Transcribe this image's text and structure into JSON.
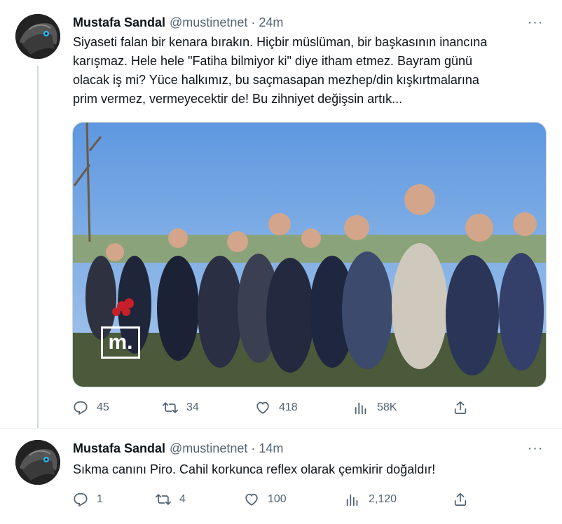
{
  "tweets": [
    {
      "author_name": "Mustafa Sandal",
      "handle": "@mustinetnet",
      "separator": "·",
      "time": "24m",
      "more": "···",
      "text": "Siyaseti falan bir kenara bırakın. Hiçbir müslüman, bir başkasının inancına\nkarışmaz. Hele hele \"Fatiha bilmiyor ki\" diye itham etmez. Bayram günü\nolacak iş mi? Yüce halkımız, bu saçmasapan mezhep/din kışkırtmalarına\nprim vermez, vermeyecektir de! Bu zihniyet değişsin artık...",
      "media_watermark": "m.",
      "stats": {
        "replies": "45",
        "retweets": "34",
        "likes": "418",
        "views": "58K"
      }
    },
    {
      "author_name": "Mustafa Sandal",
      "handle": "@mustinetnet",
      "separator": "·",
      "time": "14m",
      "more": "···",
      "text": "Sıkma canını Piro. Cahil korkunca reflex olarak çemkirir doğaldır!",
      "stats": {
        "replies": "1",
        "retweets": "4",
        "likes": "100",
        "views": "2,120"
      }
    }
  ],
  "icons": [
    "reply-icon",
    "retweet-icon",
    "like-icon",
    "views-icon",
    "share-icon",
    "more-icon"
  ],
  "colors": {
    "text": "#0f1419",
    "secondary": "#536471",
    "divider": "#eff3f4"
  }
}
